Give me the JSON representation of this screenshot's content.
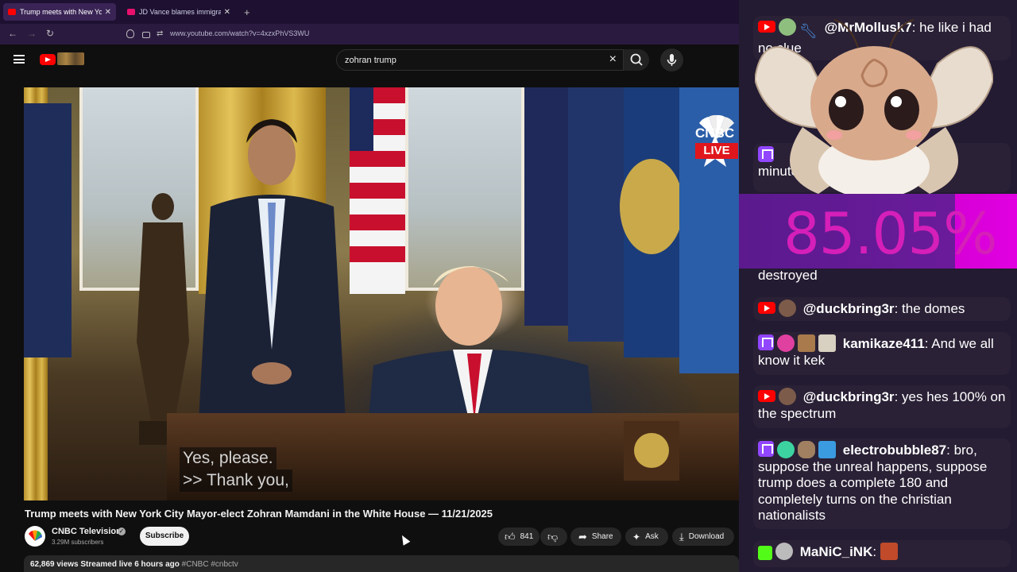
{
  "browser": {
    "tabs": [
      {
        "title": "Trump meets with New York Cit",
        "active": true
      },
      {
        "title": "JD Vance blames immigration f",
        "active": false
      }
    ],
    "url": "www.youtube.com/watch?v=4xzxPhVS3WU"
  },
  "youtube": {
    "search_value": "zohran trump",
    "video": {
      "channel_logo_text": "CNBC",
      "live_label": "LIVE",
      "captions": [
        "Yes, please.",
        ">> Thank you,"
      ],
      "title": "Trump meets with New York City Mayor-elect Zohran Mamdani in the White House — 11/21/2025",
      "channel": "CNBC Television",
      "subscribers": "3.29M subscribers",
      "subscribe_label": "Subscribe",
      "likes": "841",
      "share_label": "Share",
      "ask_label": "Ask",
      "download_label": "Download",
      "views": "62,869 views",
      "streamed": "Streamed live 6 hours ago",
      "tags": "#CNBC #cnbctv"
    }
  },
  "overlay": {
    "percent": "85.05%",
    "chat": [
      {
        "platform": "youtube",
        "user": "@MrMollusk7",
        "text": "he like i had no clue"
      },
      {
        "platform": "twitch",
        "user": "",
        "text": "minutes a…trump will immediate"
      },
      {
        "platform": "youtube",
        "user": "",
        "text": "destroyed"
      },
      {
        "platform": "youtube",
        "user": "@duckbring3r",
        "text": "the domes"
      },
      {
        "platform": "twitch",
        "user": "kamikaze411",
        "text": "And we all know it kek"
      },
      {
        "platform": "youtube",
        "user": "@duckbring3r",
        "text": "yes hes 100% on the spectrum"
      },
      {
        "platform": "twitch",
        "user": "electrobubble87",
        "text": "bro, suppose the unreal happens, suppose trump does a complete 180 and completely turns on the christian nationalists"
      },
      {
        "platform": "kick",
        "user": "MaNiC_iNK",
        "text": ""
      }
    ]
  },
  "colors": {
    "accent": "#ff0000",
    "twitch": "#9146ff",
    "overlay_bg": "#231b32",
    "pct_text": "#d51fb8"
  }
}
